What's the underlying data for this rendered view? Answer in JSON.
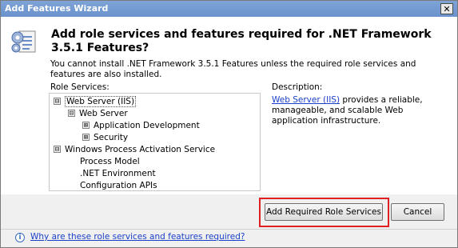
{
  "window": {
    "title": "Add Features Wizard",
    "close_glyph": "✕"
  },
  "header": {
    "icon": "wizard-features-icon",
    "heading": "Add role services and features required for .NET Framework 3.5.1 Features?"
  },
  "body": {
    "message": "You cannot install .NET Framework 3.5.1 Features unless the required role services and features are also installed."
  },
  "role_services": {
    "label": "Role Services:",
    "items": [
      {
        "label": "Web Server (IIS)",
        "expander": "⊟",
        "selected": true
      },
      {
        "label": "Web Server",
        "expander": "⊟"
      },
      {
        "label": "Application Development",
        "expander": "⊞"
      },
      {
        "label": "Security",
        "expander": "⊞"
      },
      {
        "label": "Windows Process Activation Service",
        "expander": "⊟"
      },
      {
        "label": "Process Model"
      },
      {
        "label": ".NET Environment"
      },
      {
        "label": "Configuration APIs"
      }
    ]
  },
  "description": {
    "label": "Description:",
    "link_text": "Web Server (IIS)",
    "text": " provides a reliable, manageable, and scalable Web application infrastructure."
  },
  "buttons": {
    "add_label": "Add Required Role Services",
    "cancel_label": "Cancel"
  },
  "footer": {
    "help_icon_glyph": "i",
    "link_text": "Why are these role services and features required?"
  },
  "colors": {
    "highlight": "#e02020",
    "link": "#1a3fc8",
    "titlebar": "#7fa3d6"
  }
}
